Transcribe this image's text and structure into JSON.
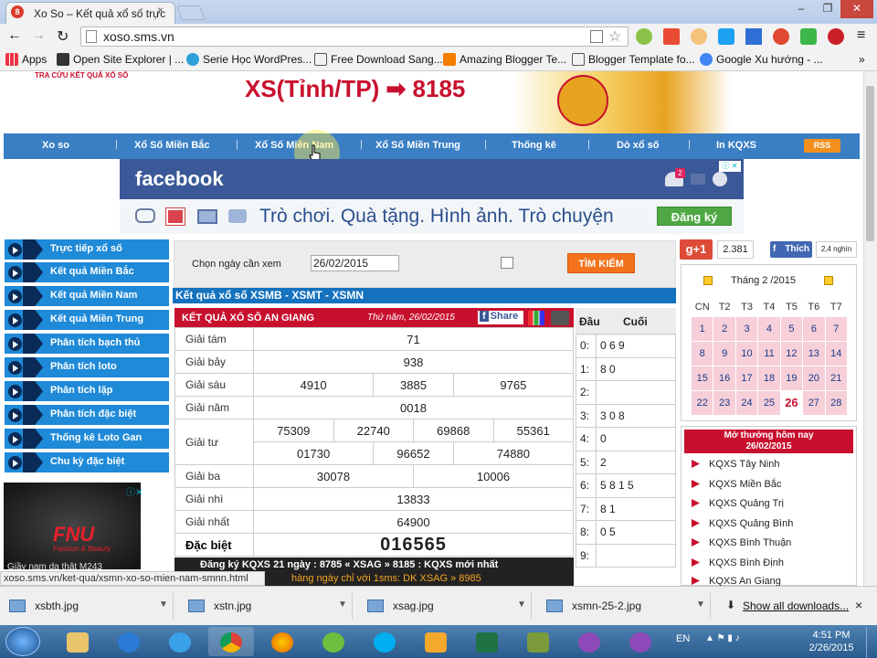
{
  "browser": {
    "tab_title": "Xo So – Kết quả xổ số trực",
    "tab_close": "×",
    "url": "xoso.sms.vn",
    "bookmarks": [
      "Apps",
      "Open Site Explorer | ...",
      "Serie Học WordPres...",
      "Free Download Sang...",
      "Amazing Blogger Te...",
      "Blogger Template fo...",
      "Google Xu hướng - ..."
    ],
    "bookmark_more": "»"
  },
  "banner": {
    "sub": "TRA CỨU KẾT QUẢ XỔ SỐ",
    "title": "XS(Tỉnh/TP) ➡ 8185"
  },
  "nav": [
    "Xo so",
    "Xổ Số Miền Bắc",
    "Xổ Số Miền Nam",
    "Xổ Số Miền Trung",
    "Thống kê",
    "Dò xổ số",
    "In KQXS"
  ],
  "rss": "RSS",
  "ad": {
    "logo": "facebook",
    "tagline": "Trò chơi. Quà tặng. Hình ảnh. Trò chuyện",
    "button": "Đăng ký",
    "badge": "2"
  },
  "sidebar": [
    "Trực tiếp xổ số",
    "Kết quả Miền Bắc",
    "Kết quả Miền Nam",
    "Kết quả Miền Trung",
    "Phân tích bạch thủ",
    "Phân tích loto",
    "Phân tích lặp",
    "Phân tích đặc biệt",
    "Thống kê Loto Gan",
    "Chu kỳ đặc biệt"
  ],
  "side_ad": {
    "logo": "FNU",
    "sub": "Fashion & Beauty",
    "caption": "Giầy nam da thật M243"
  },
  "search": {
    "label": "Chọn ngày cần xem",
    "date": "26/02/2015",
    "button": "TÌM KIẾM"
  },
  "results_header": "Kết quả xổ số XSMB - XSMT - XSMN",
  "result": {
    "title": "KẾT QUẢ XỔ SỐ AN GIANG",
    "date": "Thứ năm, 26/02/2015",
    "share": "Share",
    "rows": [
      {
        "label": "Giải tám",
        "values": [
          "71"
        ]
      },
      {
        "label": "Giải bảy",
        "values": [
          "938"
        ]
      },
      {
        "label": "Giải sáu",
        "values": [
          "4910",
          "3885",
          "9765"
        ]
      },
      {
        "label": "Giải năm",
        "values": [
          "0018"
        ]
      },
      {
        "label": "Giải tư",
        "values": [
          "75309",
          "22740",
          "69868",
          "55361",
          "01730",
          "96652",
          "74880"
        ]
      },
      {
        "label": "Giải ba",
        "values": [
          "30078",
          "10006"
        ]
      },
      {
        "label": "Giải nhì",
        "values": [
          "13833"
        ]
      },
      {
        "label": "Giải nhất",
        "values": [
          "64900"
        ]
      },
      {
        "label": "Đặc biệt",
        "values": [
          "016565"
        ]
      }
    ],
    "ticker1": "Đăng ký KQXS 21 ngày : 8785 « XSAG » 8185 : KQXS mới nhất",
    "ticker2": "hàng ngày chỉ với 1sms: DK XSAG »  8985"
  },
  "dau_duoi": {
    "head_dau": "Đầu",
    "head_duoi": "Cuối",
    "rows": [
      [
        "0:",
        "0 6 9"
      ],
      [
        "1:",
        "8 0"
      ],
      [
        "2:",
        ""
      ],
      [
        "3:",
        "3 0 8"
      ],
      [
        "4:",
        "0"
      ],
      [
        "5:",
        "2"
      ],
      [
        "6:",
        "5 8 1 5"
      ],
      [
        "7:",
        "8 1"
      ],
      [
        "8:",
        "0 5"
      ],
      [
        "9:",
        ""
      ]
    ]
  },
  "social": {
    "gplus": "g+1",
    "gcount": "2.381",
    "fblike": "Thích",
    "fbcount": "2,4 nghìn"
  },
  "calendar": {
    "month": "Tháng 2 /2015",
    "days": [
      "CN",
      "T2",
      "T3",
      "T4",
      "T5",
      "T6",
      "T7"
    ],
    "weeks": [
      [
        "1",
        "2",
        "3",
        "4",
        "5",
        "6",
        "7"
      ],
      [
        "8",
        "9",
        "10",
        "11",
        "12",
        "13",
        "14"
      ],
      [
        "15",
        "16",
        "17",
        "18",
        "19",
        "20",
        "21"
      ],
      [
        "22",
        "23",
        "24",
        "25",
        "26",
        "27",
        "28"
      ]
    ],
    "today": "26"
  },
  "mo_thuong": {
    "head1": "Mở thưởng hôm nay",
    "head2": "26/02/2015",
    "items": [
      "KQXS Tây Ninh",
      "KQXS Miền Bắc",
      "KQXS Quảng Trị",
      "KQXS Quảng Bình",
      "KQXS Bình Thuận",
      "KQXS Bình Định",
      "KQXS An Giang"
    ]
  },
  "status_url": "xoso.sms.vn/ket-qua/xsmn-xo-so-mien-nam-smnn.html",
  "downloads": {
    "files": [
      "xsbth.jpg",
      "xstn.jpg",
      "xsag.jpg",
      "xsmn-25-2.jpg"
    ],
    "show_all": "Show all downloads...",
    "close": "×"
  },
  "taskbar": {
    "lang": "EN",
    "time": "4:51 PM",
    "date": "2/26/2015"
  }
}
